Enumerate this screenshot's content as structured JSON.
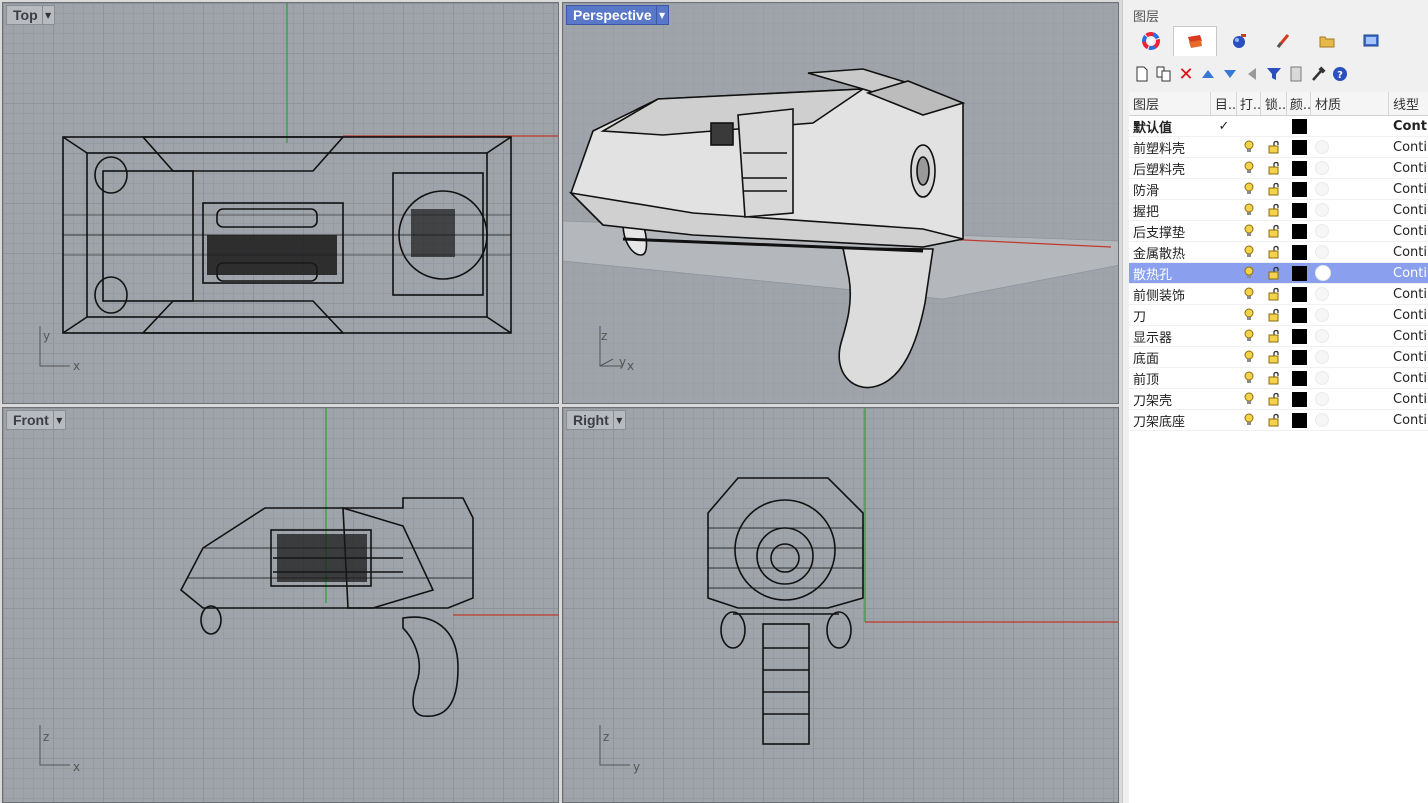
{
  "viewports": {
    "top": {
      "label": "Top",
      "axis1": "y",
      "axis2": "x"
    },
    "perspective": {
      "label": "Perspective",
      "axis1": "z",
      "axis2": "y",
      "axis3": "x"
    },
    "front": {
      "label": "Front",
      "axis1": "z",
      "axis2": "x"
    },
    "right": {
      "label": "Right",
      "axis1": "z",
      "axis2": "y"
    }
  },
  "panel": {
    "title": "图层",
    "tabs": [
      "color-wheel-icon",
      "layers-icon",
      "render-icon",
      "brush-icon",
      "folder-icon",
      "display-icon"
    ],
    "toolbar": [
      "new-layer-icon",
      "new-sublayer-icon",
      "delete-icon",
      "move-up-icon",
      "move-down-icon",
      "move-out-icon",
      "filter-icon",
      "page-icon",
      "tools-icon",
      "help-icon"
    ],
    "columns": {
      "name": "图层",
      "current": "目..",
      "on": "打..",
      "lock": "锁..",
      "color": "颜..",
      "material": "材质",
      "linetype": "线型"
    },
    "layers": [
      {
        "name": "默认值",
        "current": "✓",
        "linetype": "Conti",
        "default": true
      },
      {
        "name": "前塑料壳",
        "linetype": "Conti"
      },
      {
        "name": "后塑料壳",
        "linetype": "Conti"
      },
      {
        "name": "防滑",
        "linetype": "Conti"
      },
      {
        "name": "握把",
        "linetype": "Conti"
      },
      {
        "name": "后支撑垫",
        "linetype": "Conti"
      },
      {
        "name": "金属散热",
        "linetype": "Conti"
      },
      {
        "name": "散热孔",
        "linetype": "Conti",
        "selected": true
      },
      {
        "name": "前侧装饰",
        "linetype": "Conti"
      },
      {
        "name": "刀",
        "linetype": "Conti"
      },
      {
        "name": "显示器",
        "linetype": "Conti"
      },
      {
        "name": "底面",
        "linetype": "Conti"
      },
      {
        "name": "前顶",
        "linetype": "Conti"
      },
      {
        "name": "刀架壳",
        "linetype": "Conti"
      },
      {
        "name": "刀架底座",
        "linetype": "Conti"
      }
    ]
  },
  "colors": {
    "viewport_bg": "#9fa4aa",
    "active_tab": "#5a78c8",
    "selected_row": "#8aa0ee",
    "x_axis": "#c0392b",
    "y_axis": "#2e9e3a"
  }
}
